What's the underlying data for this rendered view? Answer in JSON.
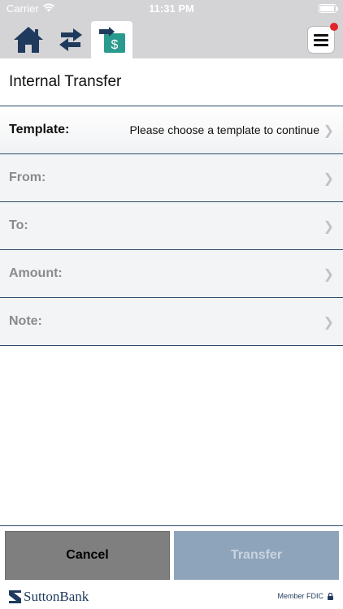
{
  "status_bar": {
    "carrier": "Carrier",
    "time": "11:31 PM"
  },
  "nav": {
    "icons": [
      "home-icon",
      "swap-arrows-icon",
      "transfer-dollar-icon",
      "hamburger-menu-icon"
    ],
    "colors": {
      "icon_primary": "#1f3a5c",
      "icon_teal": "#2a9a8e",
      "notification": "#e0242b"
    }
  },
  "page": {
    "title": "Internal Transfer"
  },
  "form": {
    "rows": [
      {
        "label": "Template:",
        "value": "Please choose a template to continue"
      },
      {
        "label": "From:",
        "value": ""
      },
      {
        "label": "To:",
        "value": ""
      },
      {
        "label": "Amount:",
        "value": ""
      },
      {
        "label": "Note:",
        "value": ""
      }
    ]
  },
  "actions": {
    "cancel_label": "Cancel",
    "transfer_label": "Transfer"
  },
  "footer": {
    "brand": "SuttonBank",
    "fdic": "Member FDIC"
  }
}
